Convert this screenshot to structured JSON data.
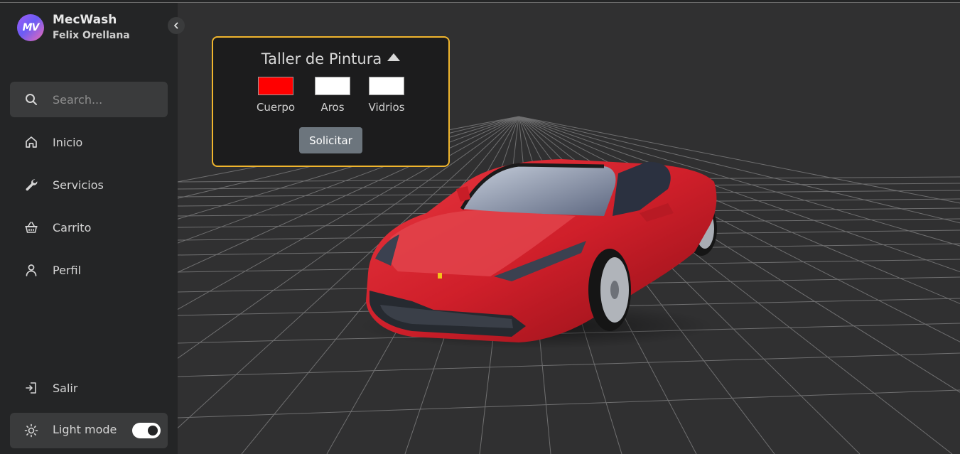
{
  "brand": {
    "name": "MecWash",
    "user": "Felix Orellana",
    "logo_initials": "MV"
  },
  "search": {
    "placeholder": "Search..."
  },
  "nav": [
    {
      "label": "Inicio",
      "icon": "home-icon"
    },
    {
      "label": "Servicios",
      "icon": "wrench-icon"
    },
    {
      "label": "Carrito",
      "icon": "basket-icon"
    },
    {
      "label": "Perfil",
      "icon": "user-icon"
    }
  ],
  "logout": {
    "label": "Salir",
    "icon": "logout-icon"
  },
  "mode": {
    "label": "Light mode",
    "icon": "sun-icon",
    "enabled": true
  },
  "panel": {
    "title": "Taller de Pintura",
    "swatches": [
      {
        "label": "Cuerpo",
        "color": "#ff0000"
      },
      {
        "label": "Aros",
        "color": "#ffffff"
      },
      {
        "label": "Vidrios",
        "color": "#ffffff"
      }
    ],
    "button": "Solicitar"
  },
  "colors": {
    "accent_border": "#f0b52d",
    "car_body": "#d4202b",
    "sidebar_bg": "#242526"
  }
}
